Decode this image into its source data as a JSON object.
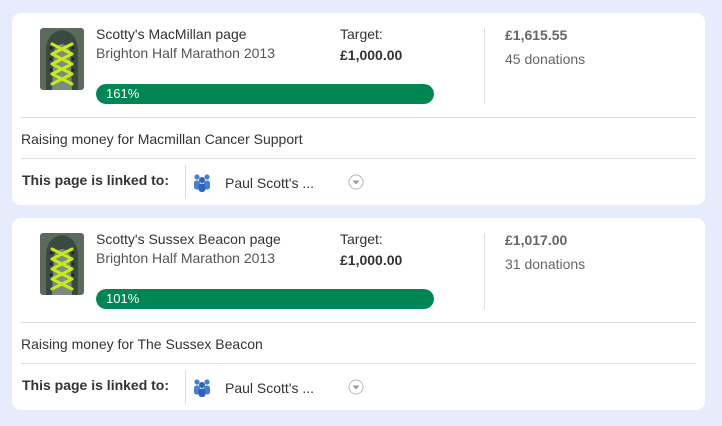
{
  "colors": {
    "page_background": "#e6ecfb",
    "progress_fill": "#008555",
    "team_icon": "#4a7fd0"
  },
  "pages": [
    {
      "thumbnail_icon": "running-shoe-icon",
      "title": "Scotty's MacMillan page",
      "event": "Brighton Half Marathon 2013",
      "target_label": "Target:",
      "target_value": "£1,000.00",
      "progress_label": "161%",
      "progress_fraction": 1.0,
      "raised": "£1,615.55",
      "donations": "45 donations",
      "charity_text": "Raising money for Macmillan Cancer Support",
      "linked_label": "This page is linked to:",
      "linked_icon": "team-icon",
      "linked_name": "Paul Scott's ...",
      "dropdown_icon": "chevron-down-icon"
    },
    {
      "thumbnail_icon": "running-shoe-icon",
      "title": "Scotty's Sussex Beacon page",
      "event": "Brighton Half Marathon 2013",
      "target_label": "Target:",
      "target_value": "£1,000.00",
      "progress_label": "101%",
      "progress_fraction": 1.0,
      "raised": "£1,017.00",
      "donations": "31 donations",
      "charity_text": "Raising money for The Sussex Beacon",
      "linked_label": "This page is linked to:",
      "linked_icon": "team-icon",
      "linked_name": "Paul Scott's ...",
      "dropdown_icon": "chevron-down-icon"
    }
  ]
}
